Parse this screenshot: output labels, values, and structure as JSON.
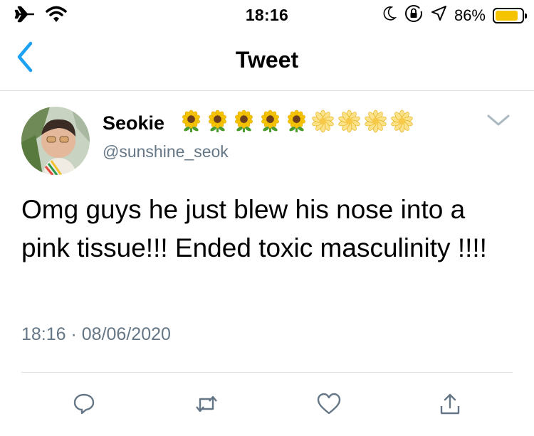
{
  "status_bar": {
    "time": "18:16",
    "battery_percent": "86%",
    "battery_level": 0.86,
    "icons": [
      "airplane-icon",
      "wifi-icon",
      "moon-icon",
      "rotation-lock-icon",
      "location-icon",
      "battery-icon"
    ]
  },
  "nav": {
    "title": "Tweet",
    "back_icon": "chevron-left-icon"
  },
  "tweet": {
    "display_name": "Seokie",
    "name_emoji": [
      "sunflower",
      "sunflower",
      "sunflower",
      "sunflower",
      "sunflower",
      "blossom",
      "blossom",
      "blossom",
      "blossom"
    ],
    "username": "@sunshine_seok",
    "text": "Omg guys he just blew his nose into a pink tissue!!! Ended toxic masculinity !!!!",
    "timestamp": "18:16 · 08/06/2020"
  },
  "actions": [
    "reply-icon",
    "retweet-icon",
    "like-icon",
    "share-icon"
  ],
  "colors": {
    "accent": "#1da1f2",
    "secondary_text": "#657786",
    "divider": "#dadfe3",
    "battery": "#f5c400"
  }
}
